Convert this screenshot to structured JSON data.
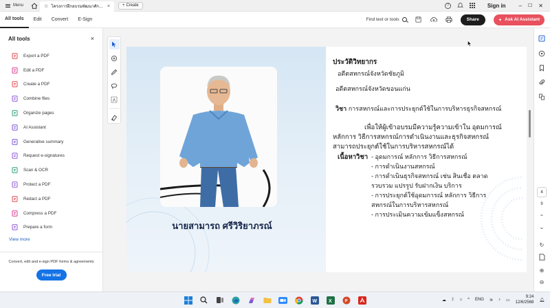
{
  "tabbar": {
    "menu_label": "Menu",
    "active_tab_title": "โครงการฝึกอบรมพัฒนาศักยภ...",
    "create_label": "Create",
    "signin_label": "Sign in"
  },
  "toolbar": {
    "tabs": [
      "All tools",
      "Edit",
      "Convert",
      "E-Sign"
    ],
    "find_label": "Find text or tools",
    "share_label": "Share",
    "ai_label": "Ask AI Assistant"
  },
  "left_panel": {
    "title": "All tools",
    "tools": [
      {
        "label": "Export a PDF",
        "color": "#e34850"
      },
      {
        "label": "Edit a PDF",
        "color": "#d83790"
      },
      {
        "label": "Create a PDF",
        "color": "#e34850"
      },
      {
        "label": "Combine files",
        "color": "#8e57d8"
      },
      {
        "label": "Organize pages",
        "color": "#2d9d78"
      },
      {
        "label": "AI Assistant",
        "color": "#7a53d6"
      },
      {
        "label": "Generative summary",
        "color": "#7a53d6"
      },
      {
        "label": "Request e-signatures",
        "color": "#8e57d8"
      },
      {
        "label": "Scan & OCR",
        "color": "#2d9d78"
      },
      {
        "label": "Protect a PDF",
        "color": "#8e57d8"
      },
      {
        "label": "Redact a PDF",
        "color": "#e34850"
      },
      {
        "label": "Compress a PDF",
        "color": "#d83790"
      },
      {
        "label": "Prepare a form",
        "color": "#8e57d8"
      }
    ],
    "view_more": "View more",
    "promo_text": "Convert, edit and e-sign PDF forms & agreements",
    "free_trial": "Free trial"
  },
  "document": {
    "person_name": "นายสามารถ ศรีวิริยาภรณ์",
    "heading": "ประวัติวิทยากร",
    "bio": [
      "อดีตสหกรณ์จังหวัดชัยภูมิ",
      "อดีตสหกรณ์จังหวัดขอนแก่น"
    ],
    "subject_label": "วิชา",
    "subject_text": "การสหกรณ์และการประยุกต์ใช้ในการบริหารธุรกิจสหกรณ์",
    "objective_lines": [
      "เพื่อให้ผู้เข้าอบรมมีความรู้ความเข้าใน อุดมการณ์",
      "หลักการ วิธีการสหกรณ์การดำเนินงานและธุรกิจสหกรณ์",
      "สามารถประยุกต์ใช้ในการบริหารสหกรณ์ได้"
    ],
    "content_label": "เนื้อหาวิชา",
    "content_items": [
      "- อุดมการณ์ หลักการ วิธีการสหกรณ์",
      "- การดำเนินงานสหกรณ์",
      "- การดำเนินธุรกิจสหกรณ์ เช่น สินเชื่อ ตลาด",
      "  รวบรวม แปรรูป รับฝากเงิน บริการ",
      "- การประยุกต์ใช้อุดมการณ์ หลักการ วิธีการ",
      "  สหกรณ์ในการบริหารสหกรณ์",
      "- การประเมินความเข้มแข็งสหกรณ์"
    ]
  },
  "right_rail": {
    "current_page": "4",
    "total_pages": "9"
  },
  "taskbar": {
    "language": "ENG",
    "time": "9:24",
    "date": "12/6/2568"
  }
}
